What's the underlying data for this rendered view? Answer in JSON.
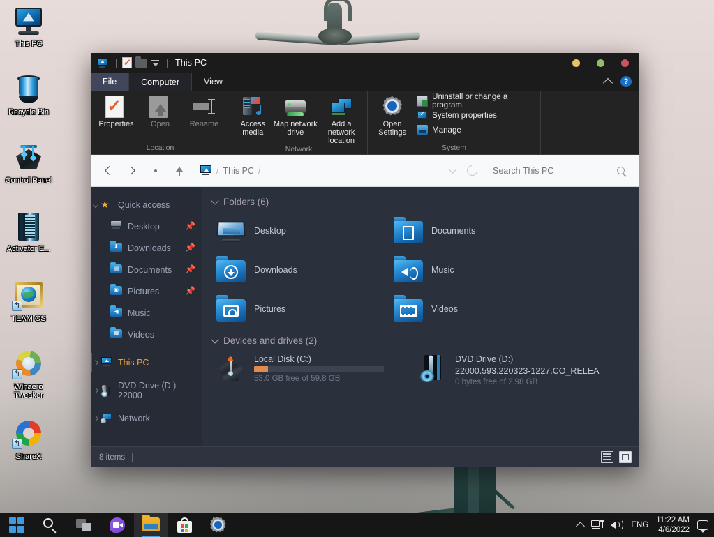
{
  "desktop": {
    "icons": [
      {
        "label": "This PC",
        "icon": "computer-icon",
        "shortcut": false
      },
      {
        "label": "Recycle Bin",
        "icon": "recycle-bin-icon",
        "shortcut": false
      },
      {
        "label": "Control Panel",
        "icon": "control-panel-icon",
        "shortcut": false
      },
      {
        "label": "Activator E...",
        "icon": "activator-icon",
        "shortcut": false
      },
      {
        "label": "TEAM OS",
        "icon": "teamos-icon",
        "shortcut": true
      },
      {
        "label": "Winaero Tweaker",
        "icon": "winaero-tweaker-icon",
        "shortcut": true
      },
      {
        "label": "ShareX",
        "icon": "sharex-icon",
        "shortcut": true
      }
    ]
  },
  "window": {
    "title": "This PC",
    "quick_access": [
      "pc-icon",
      "properties-icon",
      "folder-icon",
      "dropdown-caret-icon"
    ],
    "controls": {
      "minimize": "minimize-dot",
      "maximize": "maximize-dot",
      "close": "close-dot",
      "minimize_color": "#e8c06a",
      "maximize_color": "#8fbe6e",
      "close_color": "#c8555f"
    },
    "tabs": [
      {
        "label": "File",
        "state": "file-menu"
      },
      {
        "label": "Computer",
        "state": "active"
      },
      {
        "label": "View",
        "state": "normal"
      }
    ],
    "tab_right": {
      "collapse": "chevron-up-icon",
      "help": "?"
    },
    "ribbon": {
      "groups": [
        {
          "name": "Location",
          "buttons": [
            {
              "label": "Properties",
              "icon": "properties-icon",
              "enabled": true
            },
            {
              "label": "Open",
              "icon": "open-icon",
              "enabled": false
            },
            {
              "label": "Rename",
              "icon": "rename-icon",
              "enabled": false
            }
          ]
        },
        {
          "name": "Network",
          "buttons": [
            {
              "label": "Access media",
              "icon": "access-media-icon",
              "enabled": true,
              "dropdown": true
            },
            {
              "label": "Map network drive",
              "icon": "map-network-drive-icon",
              "enabled": true,
              "dropdown": true
            },
            {
              "label": "Add a network location",
              "icon": "add-network-location-icon",
              "enabled": true,
              "dropdown": false
            }
          ]
        },
        {
          "name": "System",
          "buttons": [
            {
              "label": "Open Settings",
              "icon": "settings-gear-icon",
              "enabled": true
            }
          ],
          "items": [
            {
              "label": "Uninstall or change a program",
              "icon": "uninstall-icon"
            },
            {
              "label": "System properties",
              "icon": "system-properties-icon"
            },
            {
              "label": "Manage",
              "icon": "manage-icon"
            }
          ]
        }
      ]
    },
    "address_bar": {
      "back": "chevron-left-icon",
      "forward": "chevron-right-icon",
      "recent": "recent-locations-icon",
      "up": "up-arrow-icon",
      "breadcrumb": [
        {
          "label": "This PC",
          "icon": "pc-icon"
        }
      ],
      "separator": "/",
      "history_dropdown": "chevron-down-icon",
      "refresh": "refresh-icon",
      "search_placeholder": "Search This PC",
      "search_icon": "search-icon"
    },
    "sidebar": [
      {
        "label": "Quick access",
        "icon": "star-icon",
        "expanded": true,
        "indent": false,
        "pinned": false,
        "selected": false
      },
      {
        "label": "Desktop",
        "icon": "desktop-icon",
        "indent": true,
        "pinned": true,
        "selected": false
      },
      {
        "label": "Downloads",
        "icon": "downloads-folder-icon",
        "indent": true,
        "pinned": true,
        "selected": false
      },
      {
        "label": "Documents",
        "icon": "documents-folder-icon",
        "indent": true,
        "pinned": true,
        "selected": false
      },
      {
        "label": "Pictures",
        "icon": "pictures-folder-icon",
        "indent": true,
        "pinned": true,
        "selected": false
      },
      {
        "label": "Music",
        "icon": "music-folder-icon",
        "indent": true,
        "pinned": false,
        "selected": false
      },
      {
        "label": "Videos",
        "icon": "videos-folder-icon",
        "indent": true,
        "pinned": false,
        "selected": false
      },
      {
        "label": "This PC",
        "icon": "pc-icon",
        "indent": false,
        "pinned": false,
        "selected": true
      },
      {
        "label": "DVD Drive (D:) 22000",
        "icon": "dvd-drive-icon",
        "indent": false,
        "pinned": false,
        "selected": false
      },
      {
        "label": "Network",
        "icon": "network-icon",
        "indent": false,
        "pinned": false,
        "selected": false
      }
    ],
    "content": {
      "folders_header": "Folders (6)",
      "folders": [
        {
          "label": "Desktop",
          "icon": "desktop-icon"
        },
        {
          "label": "Documents",
          "icon": "documents-folder-icon"
        },
        {
          "label": "Downloads",
          "icon": "downloads-folder-icon"
        },
        {
          "label": "Music",
          "icon": "music-folder-icon"
        },
        {
          "label": "Pictures",
          "icon": "pictures-folder-icon"
        },
        {
          "label": "Videos",
          "icon": "videos-folder-icon"
        }
      ],
      "devices_header": "Devices and drives (2)",
      "drives": [
        {
          "name": "Local Disk (C:)",
          "subtitle": "",
          "free_text": "53.0 GB free of 59.8 GB",
          "used_percent": 11,
          "bar_color": "#e08b4f",
          "icon": "local-disk-icon",
          "has_bar": true
        },
        {
          "name": "DVD Drive (D:)",
          "subtitle": "22000.593.220323-1227.CO_RELEA",
          "free_text": "0 bytes free of 2.98 GB",
          "used_percent": 100,
          "bar_color": "#e08b4f",
          "icon": "dvd-drive-icon",
          "has_bar": false
        }
      ]
    },
    "status_bar": {
      "item_count": "8 items",
      "view_details": "details-view-icon",
      "view_large": "large-icons-view-icon"
    }
  },
  "taskbar": {
    "buttons": [
      {
        "name": "start-button",
        "icon": "windows-logo-icon",
        "active": false
      },
      {
        "name": "search-button",
        "icon": "search-icon",
        "active": false
      },
      {
        "name": "task-view-button",
        "icon": "task-view-icon",
        "active": false
      },
      {
        "name": "chat-button",
        "icon": "chat-icon",
        "active": false
      },
      {
        "name": "file-explorer-button",
        "icon": "file-explorer-icon",
        "active": true
      },
      {
        "name": "microsoft-store-button",
        "icon": "store-icon",
        "active": false
      },
      {
        "name": "settings-button",
        "icon": "settings-gear-icon",
        "active": false
      }
    ],
    "tray": {
      "overflow": "chevron-up-icon",
      "network": "network-icon",
      "volume": "volume-icon",
      "language": "ENG",
      "time": "11:22 AM",
      "date": "4/6/2022",
      "notifications": "notification-icon"
    }
  }
}
